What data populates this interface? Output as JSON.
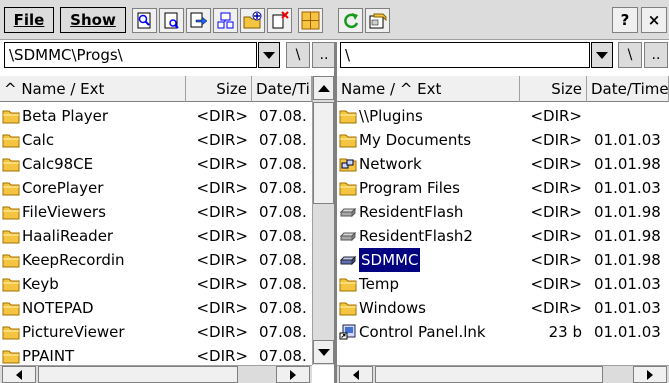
{
  "menu": {
    "file_label": "File",
    "show_label": "Show"
  },
  "toolbar_icons": [
    "find-icon",
    "view-icon",
    "copy-icon",
    "compare-icon",
    "new-folder-icon",
    "delete-icon",
    "split-view-icon",
    "refresh-icon",
    "properties-icon"
  ],
  "window_buttons": {
    "help": "?",
    "close": "×"
  },
  "left": {
    "path": "\\SDMMC\\Progs\\",
    "root_button": "\\",
    "up_button": "..",
    "columns": {
      "name": "^ Name / Ext",
      "size": "Size",
      "date": "Date/Time"
    },
    "rows": [
      {
        "name": "Beta Player",
        "size": "<DIR>",
        "date": "07.08.",
        "icon": "folder-icon"
      },
      {
        "name": "Calc",
        "size": "<DIR>",
        "date": "07.08.",
        "icon": "folder-icon"
      },
      {
        "name": "Calc98CE",
        "size": "<DIR>",
        "date": "07.08.",
        "icon": "folder-icon"
      },
      {
        "name": "CorePlayer",
        "size": "<DIR>",
        "date": "07.08.",
        "icon": "folder-icon"
      },
      {
        "name": "FileViewers",
        "size": "<DIR>",
        "date": "07.08.",
        "icon": "folder-icon"
      },
      {
        "name": "HaaliReader",
        "size": "<DIR>",
        "date": "07.08.",
        "icon": "folder-icon"
      },
      {
        "name": "KeepRecordin",
        "size": "<DIR>",
        "date": "07.08.",
        "icon": "folder-icon"
      },
      {
        "name": "Keyb",
        "size": "<DIR>",
        "date": "07.08.",
        "icon": "folder-icon"
      },
      {
        "name": "NOTEPAD",
        "size": "<DIR>",
        "date": "07.08.",
        "icon": "folder-icon"
      },
      {
        "name": "PictureViewer",
        "size": "<DIR>",
        "date": "07.08.",
        "icon": "folder-icon"
      },
      {
        "name": "PPAINT",
        "size": "<DIR>",
        "date": "07.08.",
        "icon": "folder-icon"
      }
    ]
  },
  "right": {
    "path": "\\",
    "root_button": "\\",
    "up_button": "..",
    "columns": {
      "name": "Name / ^ Ext",
      "size": "Size",
      "date": "Date/Time"
    },
    "rows": [
      {
        "name": "\\\\Plugins",
        "size": "<DIR>",
        "date": "",
        "icon": "folder-icon"
      },
      {
        "name": "My Documents",
        "size": "<DIR>",
        "date": "01.01.03",
        "icon": "folder-icon"
      },
      {
        "name": "Network",
        "size": "<DIR>",
        "date": "01.01.98",
        "icon": "network-icon"
      },
      {
        "name": "Program Files",
        "size": "<DIR>",
        "date": "01.01.03",
        "icon": "folder-icon"
      },
      {
        "name": "ResidentFlash",
        "size": "<DIR>",
        "date": "01.01.98",
        "icon": "drive-icon"
      },
      {
        "name": "ResidentFlash2",
        "size": "<DIR>",
        "date": "01.01.98",
        "icon": "drive-icon"
      },
      {
        "name": "SDMMC",
        "size": "<DIR>",
        "date": "01.01.98",
        "icon": "sd-card-icon",
        "selected": true
      },
      {
        "name": "Temp",
        "size": "<DIR>",
        "date": "01.01.03",
        "icon": "folder-icon"
      },
      {
        "name": "Windows",
        "size": "<DIR>",
        "date": "01.01.03",
        "icon": "folder-icon"
      },
      {
        "name": "Control Panel.lnk",
        "size": "23 b",
        "date": "01.01.03",
        "icon": "shortcut-icon"
      }
    ]
  },
  "colors": {
    "toolbar_bg": "#dcdcdc",
    "selection_bg": "#000080",
    "folder_yellow": "#f5c542"
  }
}
